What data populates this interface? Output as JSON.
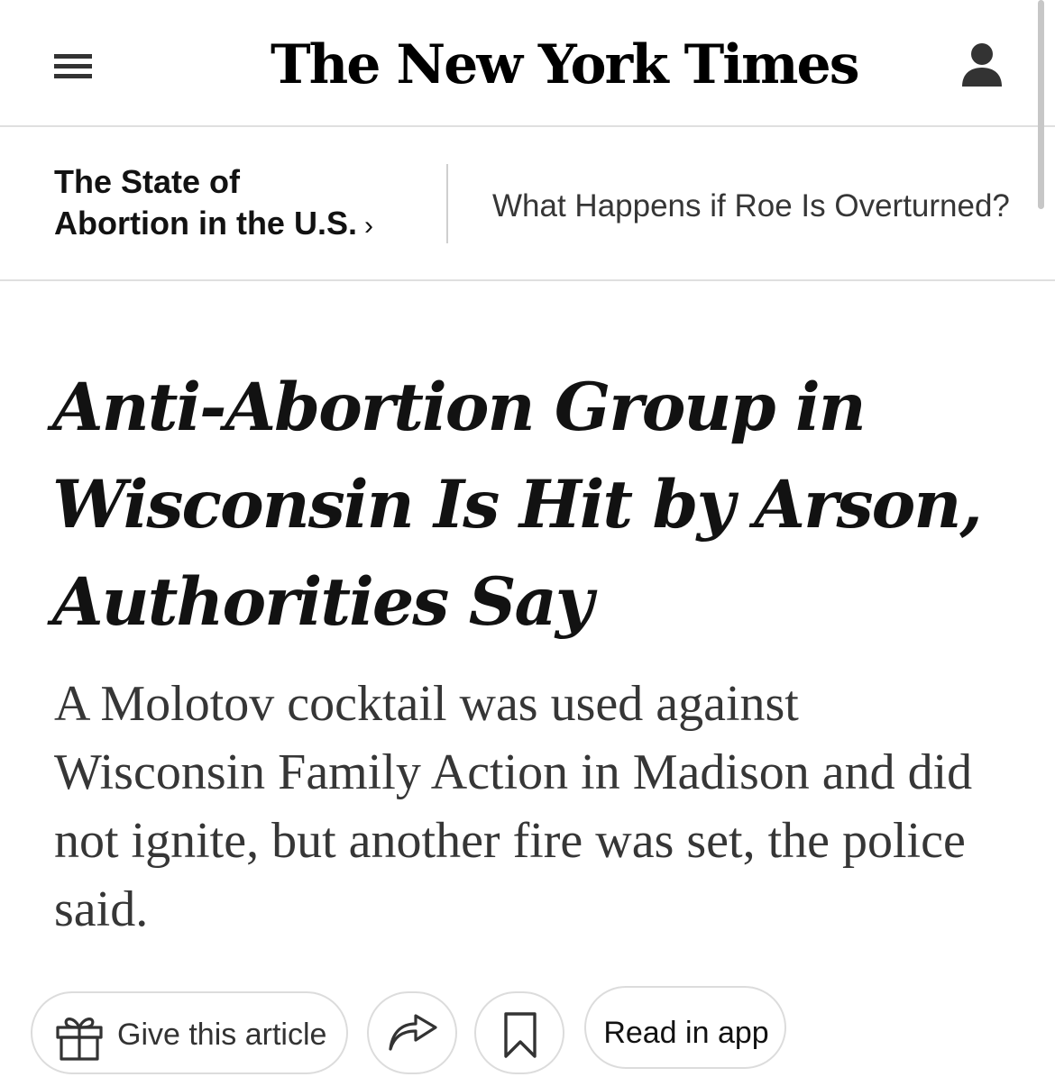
{
  "masthead": {
    "logo_text": "The New York Times",
    "menu_icon": "hamburger-menu-icon",
    "account_icon": "account-person-icon"
  },
  "section_nav": {
    "section_line1": "The State of",
    "section_line2": "Abortion in the U.S.",
    "chevron": "›",
    "related_link": "What Happens if Roe Is Overturned?"
  },
  "article": {
    "headline": "Anti-Abortion Group in Wisconsin Is Hit by Arson, Authorities Say",
    "summary": "A Molotov cocktail was used against Wisconsin Family Action in Madison and did not ignite, but another fire was set, the police said."
  },
  "actions": {
    "gift_label": "Give this article",
    "gift_icon": "gift-icon",
    "share_icon": "share-arrow-icon",
    "save_icon": "bookmark-icon",
    "read_in_app_label": "Read in app"
  },
  "colors": {
    "text_primary": "#121212",
    "text_secondary": "#363636",
    "border": "#dfdfdf"
  }
}
